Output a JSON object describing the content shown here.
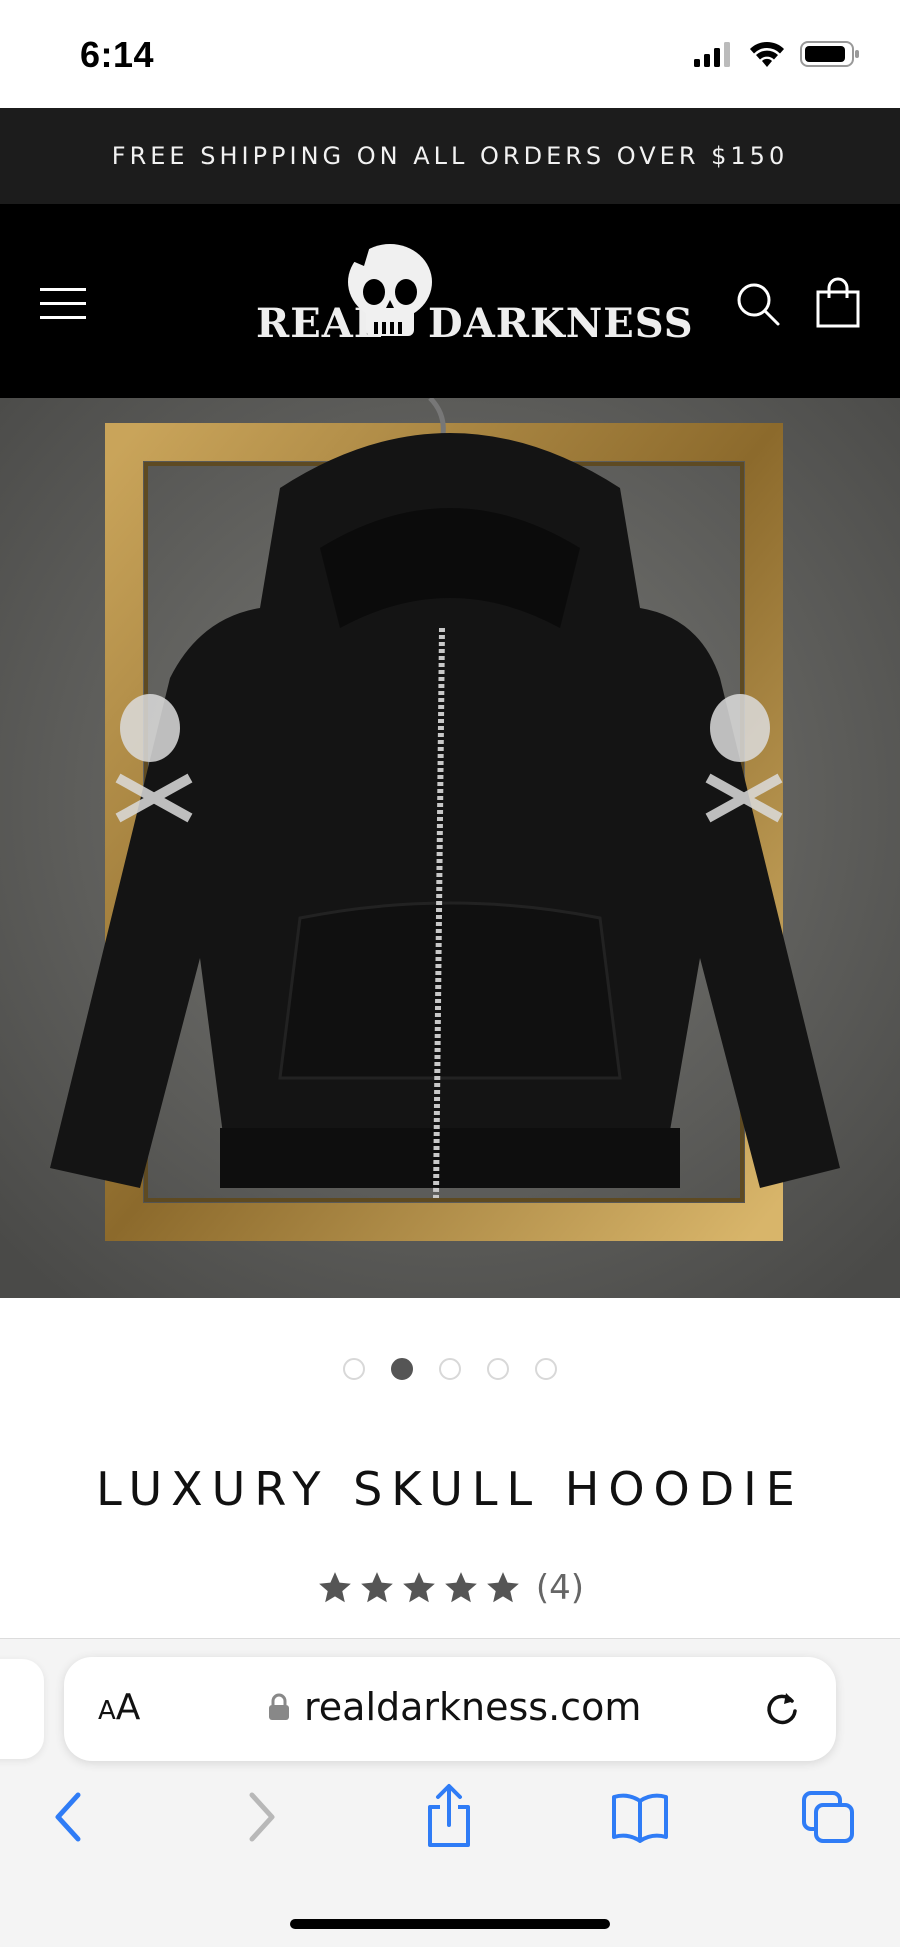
{
  "status_bar": {
    "time": "6:14"
  },
  "announcement": {
    "text": "FREE SHIPPING ON ALL ORDERS OVER $150"
  },
  "header": {
    "logo_left": "REAL",
    "logo_right": "DARKNESS"
  },
  "product": {
    "title": "LUXURY SKULL HOODIE",
    "rating": 5,
    "rating_count": "(4)",
    "image_count": 5,
    "active_image": 2
  },
  "browser": {
    "aa_small": "A",
    "aa_large": "A",
    "url": "realdarkness.com"
  },
  "colors": {
    "announcement_bg": "#1c1c1c",
    "header_bg": "#000000",
    "safari_accent": "#2f7cf6",
    "star_color": "#555555"
  }
}
